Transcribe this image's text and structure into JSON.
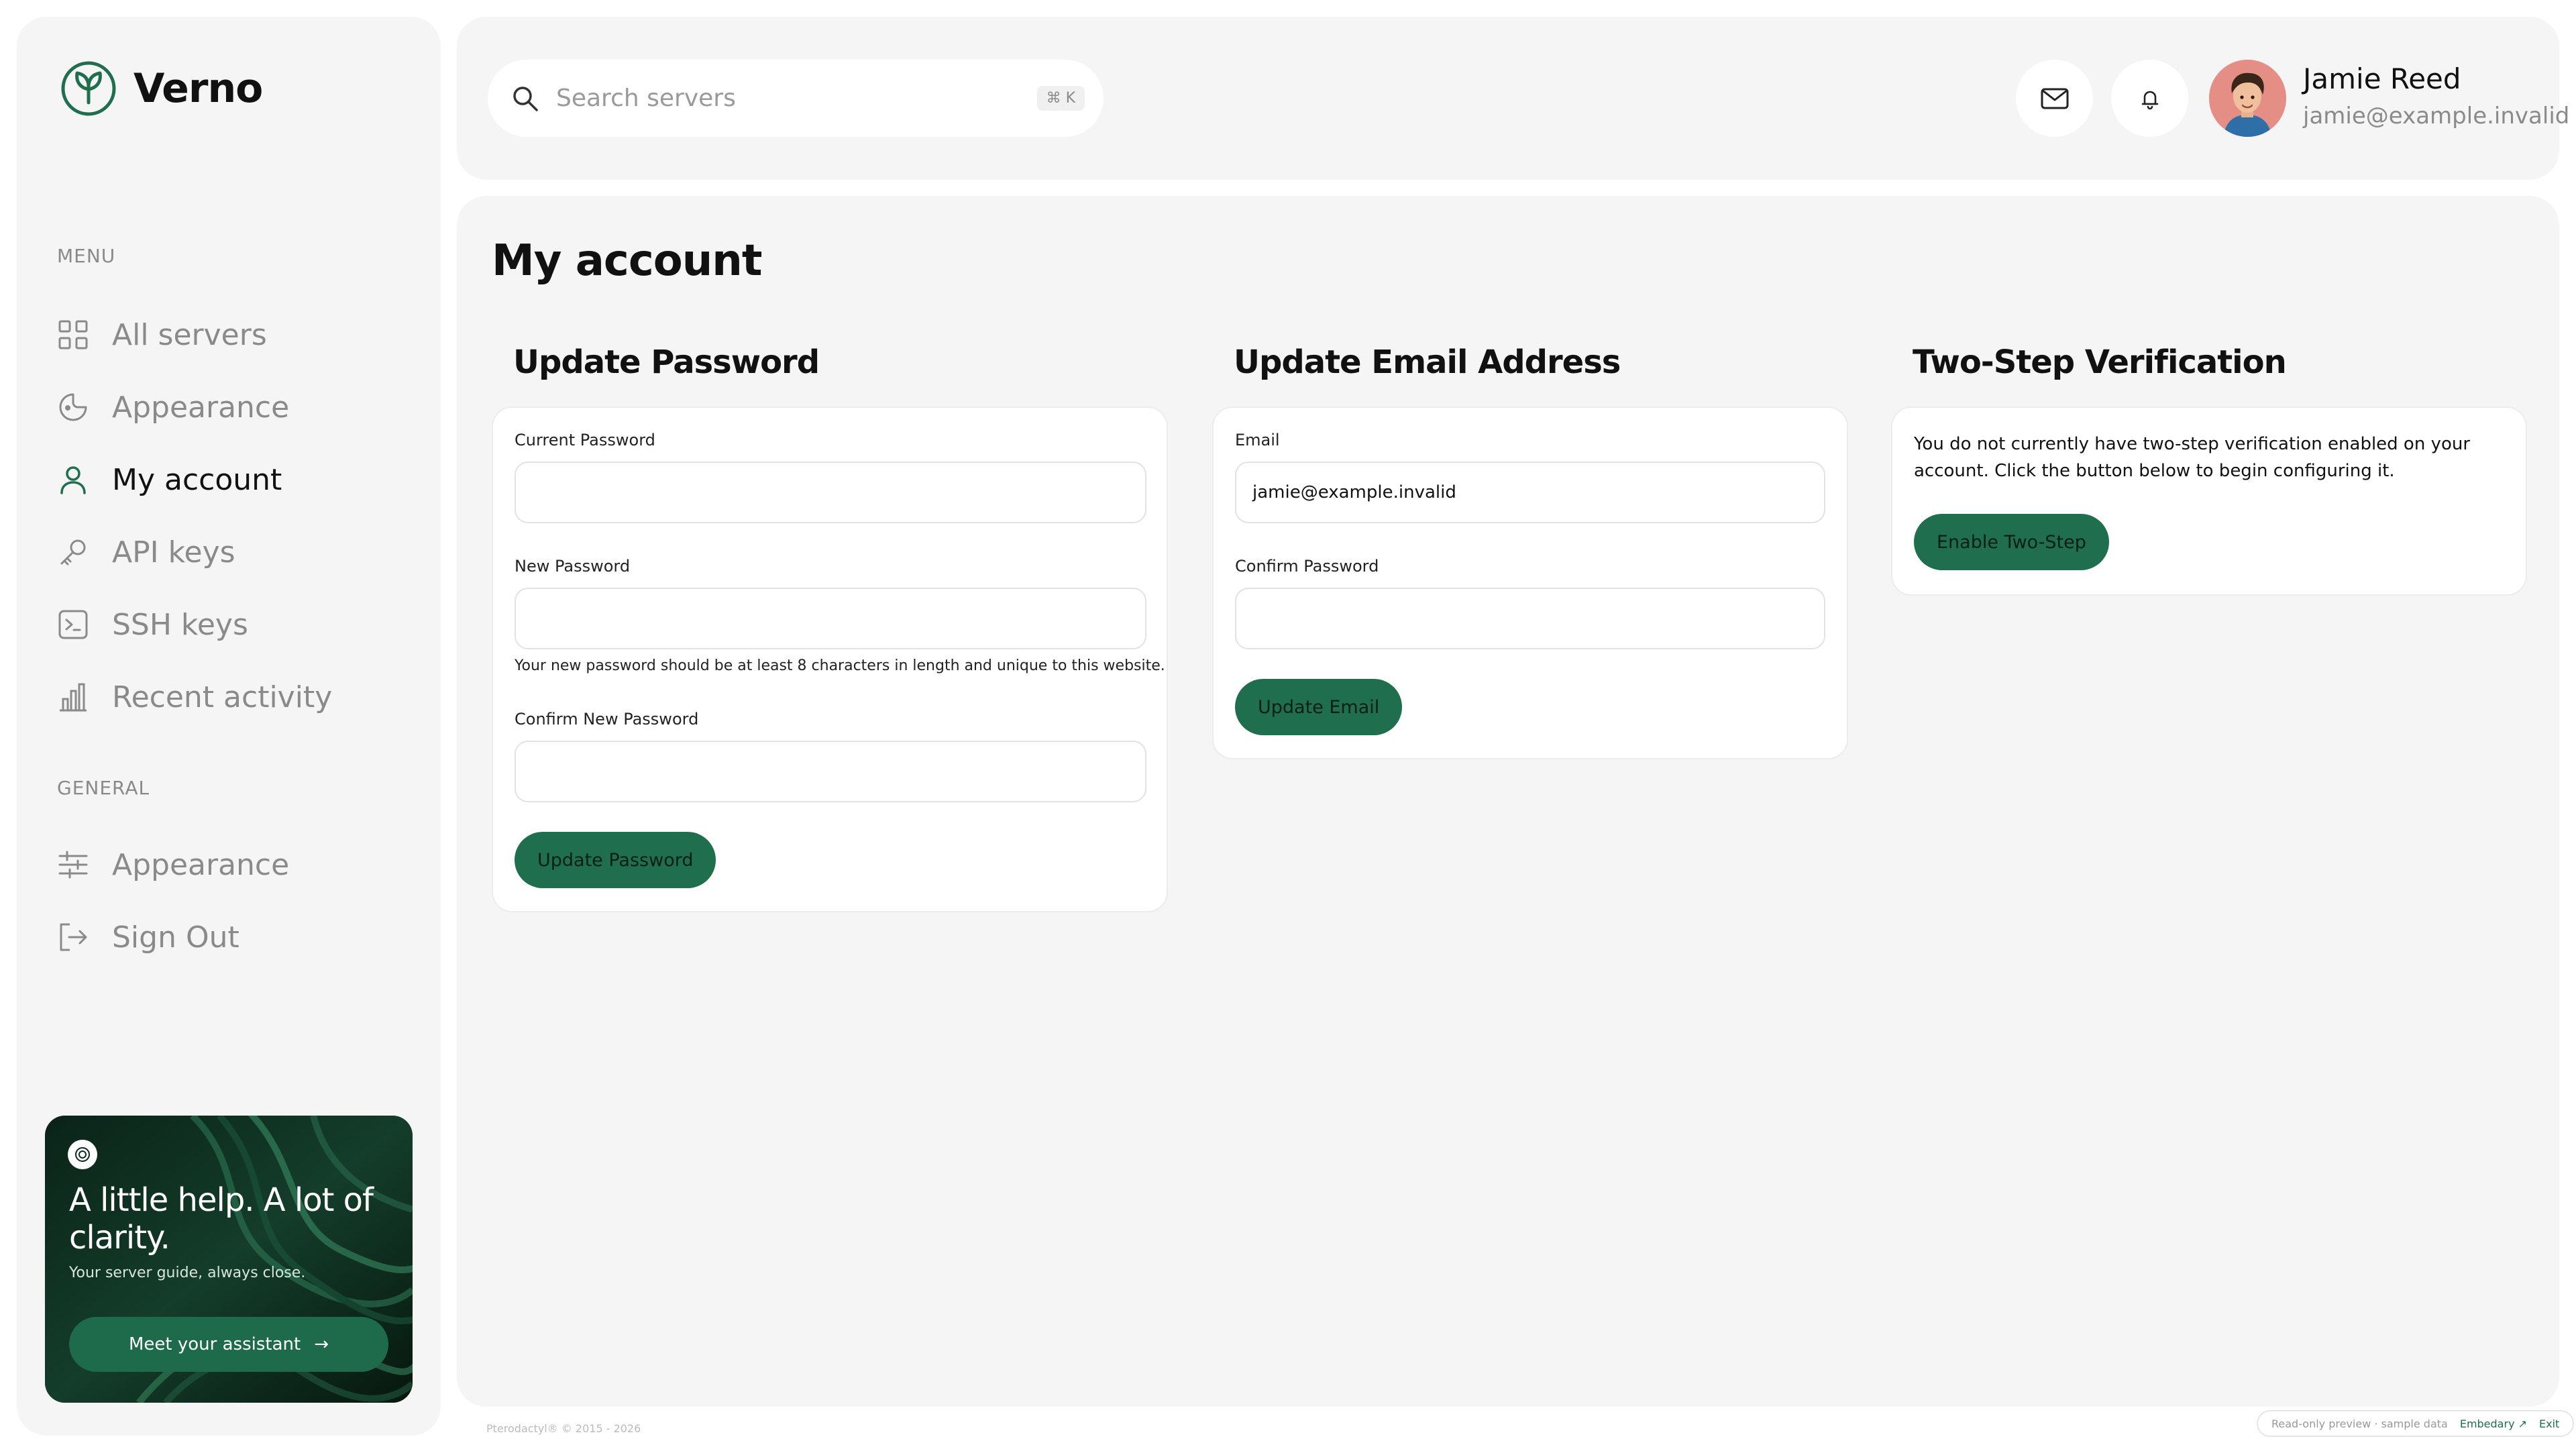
{
  "brand": {
    "name": "Verno"
  },
  "sidebar": {
    "menu_label": "MENU",
    "menu_items": [
      {
        "label": "All servers",
        "icon": "grid-icon"
      },
      {
        "label": "Appearance",
        "icon": "palette-icon"
      },
      {
        "label": "My account",
        "icon": "user-icon",
        "active": true
      },
      {
        "label": "API keys",
        "icon": "key-icon"
      },
      {
        "label": "SSH keys",
        "icon": "terminal-icon"
      },
      {
        "label": "Recent activity",
        "icon": "bar-chart-icon"
      }
    ],
    "general_label": "GENERAL",
    "general_items": [
      {
        "label": "Appearance",
        "icon": "sliders-icon"
      },
      {
        "label": "Sign Out",
        "icon": "logout-icon"
      }
    ],
    "promo": {
      "title": "A little help. A lot of clarity.",
      "subtitle": "Your server guide, always close.",
      "button": "Meet your assistant",
      "arrow": "→"
    }
  },
  "topbar": {
    "search_placeholder": "Search servers",
    "search_shortcut": "⌘ K",
    "user": {
      "name": "Jamie Reed",
      "email": "jamie@example.invalid"
    }
  },
  "main": {
    "title": "My account",
    "password": {
      "title": "Update Password",
      "current_label": "Current Password",
      "current_value": "",
      "new_label": "New Password",
      "new_value": "",
      "hint": "Your new password should be at least 8 characters in length and unique to this website.",
      "confirm_label": "Confirm New Password",
      "confirm_value": "",
      "button": "Update Password"
    },
    "email": {
      "title": "Update Email Address",
      "email_label": "Email",
      "email_value": "jamie@example.invalid",
      "confirm_label": "Confirm Password",
      "confirm_value": "",
      "button": "Update Email"
    },
    "twostep": {
      "title": "Two-Step Verification",
      "text": "You do not currently have two-step verification enabled on your account. Click the button below to begin configuring it.",
      "button": "Enable Two-Step"
    }
  },
  "footer": {
    "copyright": "Pterodactyl® © 2015 - 2026",
    "preview": "Read-only preview · sample data",
    "embedary": "Embedary ↗",
    "exit": "Exit"
  },
  "colors": {
    "accent": "#1f6e4d",
    "panel": "#f5f5f5",
    "muted": "#8a8a8a"
  }
}
